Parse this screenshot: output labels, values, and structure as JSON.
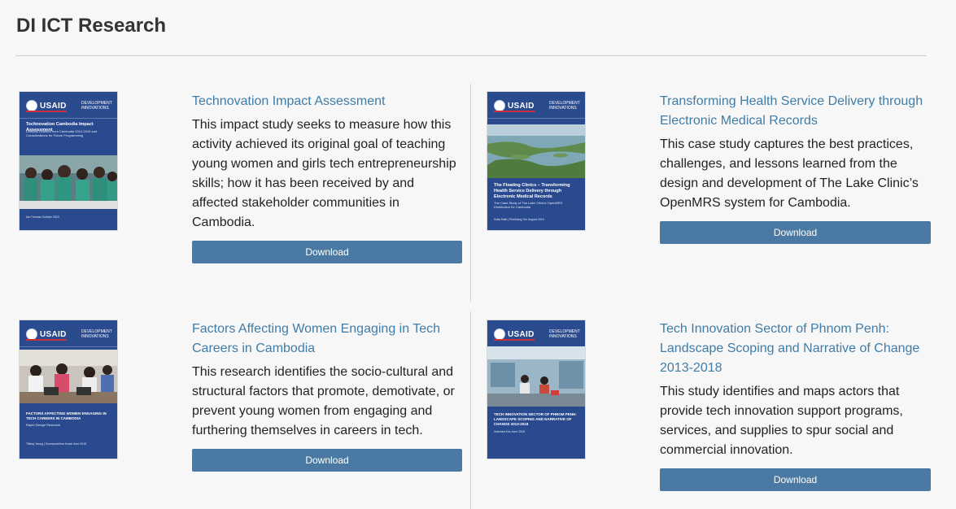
{
  "page": {
    "title": "DI ICT Research"
  },
  "documents": [
    {
      "title": "Technovation Impact Assessment",
      "description": "This impact study seeks to measure how this activity achieved its original goal of teaching young women and girls tech entrepreneurship skills; how it has been received by and affected stakeholder communities in Cambodia.",
      "download_label": "Download",
      "cover": {
        "brand": "USAID",
        "brand_secondary": "DEVELOPMENT INNOVATIONS",
        "title": "Technovation Cambodia Impact Assessment",
        "subtitle": "Lessons Learned from Cambodia 2014-2019 and Considerations for Future Programming",
        "footer": "Ian Thomas October 2019"
      }
    },
    {
      "title": "Transforming Health Service Delivery through Electronic Medical Records",
      "description": "This case study captures the best practices, challenges, and lessons learned from the design and development of The Lake Clinic’s OpenMRS system for Cambodia.",
      "download_label": "Download",
      "cover": {
        "brand": "USAID",
        "brand_secondary": "DEVELOPMENT INNOVATIONS",
        "title": "The Floating Clinics – Transforming Health Service Delivery through Electronic Medical Records",
        "subtitle": "The Case Study of The Lake Clinic’s OpenMRS Distribution for Cambodia",
        "footer": "Sofia Ratti | Pisethang Tim August 2019"
      }
    },
    {
      "title": "Factors Affecting Women Engaging in Tech Careers in Cambodia",
      "description": "This research identifies the socio-cultural and structural factors that promote, demotivate, or prevent young women from engaging and furthering themselves in careers in tech.",
      "download_label": "Download",
      "cover": {
        "brand": "USAID",
        "brand_secondary": "DEVELOPMENT INNOVATIONS",
        "title": "FACTORS AFFECTING WOMEN ENGAGING IN TECH CAREERS IN CAMBODIA",
        "subtitle": "Rapid Design Research",
        "footer": "Tiffany Yeung | Sonnamvichea Kosal June 2018"
      }
    },
    {
      "title": "Tech Innovation Sector of Phnom Penh: Landscape Scoping and Narrative of Change 2013-2018",
      "description": "This study identifies and maps actors that provide tech innovation support programs, services, and supplies to spur social and commercial innovation.",
      "download_label": "Download",
      "cover": {
        "brand": "USAID",
        "brand_secondary": "DEVELOPMENT INNOVATIONS",
        "title": "TECH INNOVATION SECTOR OF PHNOM PENH: LANDSCAPE SCOPING AND NARRATIVE OF CHANGE 2013-2018",
        "subtitle": "",
        "footer": "Sokchea Kim June 2018"
      }
    }
  ]
}
